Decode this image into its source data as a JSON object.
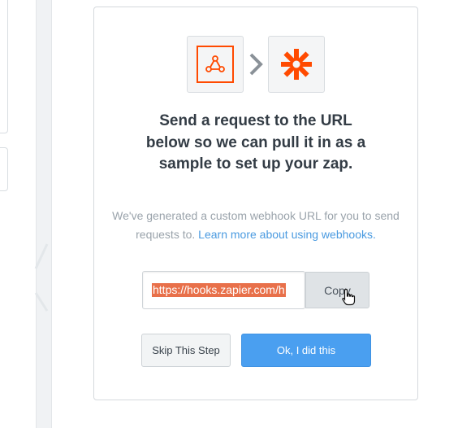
{
  "panel": {
    "heading": "Send a request to the URL below so we can pull it in as a sample to set up your zap.",
    "sub_text": "We've generated a custom webhook URL for you to send requests to.",
    "learn_more_link": "Learn more about using webhooks.",
    "webhook_url": "https://hooks.zapier.com/h",
    "copy_label": "Copy",
    "skip_label": "Skip This Step",
    "ok_label": "Ok, I did this",
    "apps": {
      "from_icon": "webhook-icon",
      "to_icon": "zapier-icon"
    }
  },
  "colors": {
    "primary": "#4a9ff0",
    "brand_orange": "#ff4a00",
    "selection": "#e8704a",
    "heading": "#333c45",
    "muted": "#9aa3ab",
    "link": "#4a9ae0"
  }
}
